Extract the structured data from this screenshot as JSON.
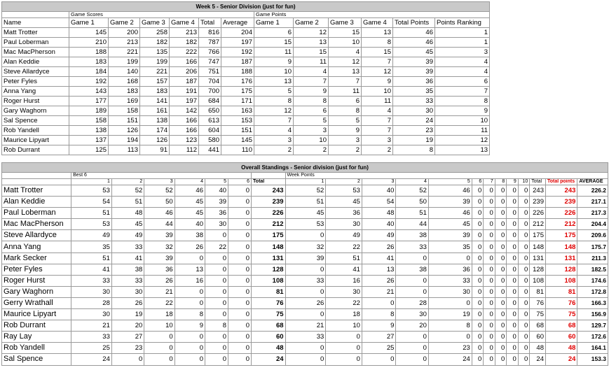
{
  "week": {
    "title": "Week 5 - Senior Division (just for fun)",
    "group_scores": "Game Scores",
    "group_points": "Game Points",
    "headers": [
      "Name",
      "Game 1",
      "Game 2",
      "Game 3",
      "Game 4",
      "Total",
      "Average",
      "Game 1",
      "Game 2",
      "Game 3",
      "Game 4",
      "Total Points",
      "Points Ranking"
    ],
    "rows": [
      [
        "Matt Trotter",
        "145",
        "200",
        "258",
        "213",
        "816",
        "204",
        "6",
        "12",
        "15",
        "13",
        "46",
        "1"
      ],
      [
        "Paul Loberman",
        "210",
        "213",
        "182",
        "182",
        "787",
        "197",
        "15",
        "13",
        "10",
        "8",
        "46",
        "1"
      ],
      [
        "Mac MacPherson",
        "188",
        "221",
        "135",
        "222",
        "766",
        "192",
        "11",
        "15",
        "4",
        "15",
        "45",
        "3"
      ],
      [
        "Alan Keddie",
        "183",
        "199",
        "199",
        "166",
        "747",
        "187",
        "9",
        "11",
        "12",
        "7",
        "39",
        "4"
      ],
      [
        "Steve Allardyce",
        "184",
        "140",
        "221",
        "206",
        "751",
        "188",
        "10",
        "4",
        "13",
        "12",
        "39",
        "4"
      ],
      [
        "Peter Fyles",
        "192",
        "168",
        "157",
        "187",
        "704",
        "176",
        "13",
        "7",
        "7",
        "9",
        "36",
        "6"
      ],
      [
        "Anna Yang",
        "143",
        "183",
        "183",
        "191",
        "700",
        "175",
        "5",
        "9",
        "11",
        "10",
        "35",
        "7"
      ],
      [
        "Roger Hurst",
        "177",
        "169",
        "141",
        "197",
        "684",
        "171",
        "8",
        "8",
        "6",
        "11",
        "33",
        "8"
      ],
      [
        "Gary Waghorn",
        "189",
        "158",
        "161",
        "142",
        "650",
        "163",
        "12",
        "6",
        "8",
        "4",
        "30",
        "9"
      ],
      [
        "Sal Spence",
        "158",
        "151",
        "138",
        "166",
        "613",
        "153",
        "7",
        "5",
        "5",
        "7",
        "24",
        "10"
      ],
      [
        "Rob Yandell",
        "138",
        "126",
        "174",
        "166",
        "604",
        "151",
        "4",
        "3",
        "9",
        "7",
        "23",
        "11"
      ],
      [
        "Maurice Lipyart",
        "137",
        "194",
        "126",
        "123",
        "580",
        "145",
        "3",
        "10",
        "3",
        "3",
        "19",
        "12"
      ],
      [
        "Rob Durrant",
        "125",
        "113",
        "91",
        "112",
        "441",
        "110",
        "2",
        "2",
        "2",
        "2",
        "8",
        "13"
      ]
    ]
  },
  "overall": {
    "title": "Overall Standings  - Senior division (just for fun)",
    "best6": "Best 6",
    "week_points": "Week Points",
    "col_nums_a": [
      "1",
      "2",
      "3",
      "4",
      "5",
      "6"
    ],
    "total_label": "Total",
    "col_nums_b": [
      "1",
      "2",
      "3",
      "4",
      "5",
      "6",
      "7",
      "8",
      "9",
      "10"
    ],
    "total_label_2": "Total",
    "total_points_label": "Total points",
    "average_label": "AVERAGE",
    "rows": [
      {
        "name": "Matt Trotter",
        "best": [
          "53",
          "52",
          "52",
          "46",
          "40",
          "0"
        ],
        "total": "243",
        "wk": [
          "52",
          "53",
          "40",
          "52",
          "46",
          "0",
          "0",
          "0",
          "0",
          "0"
        ],
        "wtotal": "243",
        "tp": "243",
        "avg": "226.2"
      },
      {
        "name": "Alan Keddie",
        "best": [
          "54",
          "51",
          "50",
          "45",
          "39",
          "0"
        ],
        "total": "239",
        "wk": [
          "51",
          "45",
          "54",
          "50",
          "39",
          "0",
          "0",
          "0",
          "0",
          "0"
        ],
        "wtotal": "239",
        "tp": "239",
        "avg": "217.1"
      },
      {
        "name": "Paul Loberman",
        "best": [
          "51",
          "48",
          "46",
          "45",
          "36",
          "0"
        ],
        "total": "226",
        "wk": [
          "45",
          "36",
          "48",
          "51",
          "46",
          "0",
          "0",
          "0",
          "0",
          "0"
        ],
        "wtotal": "226",
        "tp": "226",
        "avg": "217.3"
      },
      {
        "name": "Mac MacPherson",
        "best": [
          "53",
          "45",
          "44",
          "40",
          "30",
          "0"
        ],
        "total": "212",
        "wk": [
          "53",
          "30",
          "40",
          "44",
          "45",
          "0",
          "0",
          "0",
          "0",
          "0"
        ],
        "wtotal": "212",
        "tp": "212",
        "avg": "204.4"
      },
      {
        "name": "Steve Allardyce",
        "best": [
          "49",
          "49",
          "39",
          "38",
          "0",
          "0"
        ],
        "total": "175",
        "wk": [
          "0",
          "49",
          "49",
          "38",
          "39",
          "0",
          "0",
          "0",
          "0",
          "0"
        ],
        "wtotal": "175",
        "tp": "175",
        "avg": "209.6"
      },
      {
        "name": "Anna Yang",
        "best": [
          "35",
          "33",
          "32",
          "26",
          "22",
          "0"
        ],
        "total": "148",
        "wk": [
          "32",
          "22",
          "26",
          "33",
          "35",
          "0",
          "0",
          "0",
          "0",
          "0"
        ],
        "wtotal": "148",
        "tp": "148",
        "avg": "175.7"
      },
      {
        "name": "Mark Secker",
        "best": [
          "51",
          "41",
          "39",
          "0",
          "0",
          "0"
        ],
        "total": "131",
        "wk": [
          "39",
          "51",
          "41",
          "0",
          "0",
          "0",
          "0",
          "0",
          "0",
          "0"
        ],
        "wtotal": "131",
        "tp": "131",
        "avg": "211.3"
      },
      {
        "name": "Peter Fyles",
        "best": [
          "41",
          "38",
          "36",
          "13",
          "0",
          "0"
        ],
        "total": "128",
        "wk": [
          "0",
          "41",
          "13",
          "38",
          "36",
          "0",
          "0",
          "0",
          "0",
          "0"
        ],
        "wtotal": "128",
        "tp": "128",
        "avg": "182.5"
      },
      {
        "name": "Roger Hurst",
        "best": [
          "33",
          "33",
          "26",
          "16",
          "0",
          "0"
        ],
        "total": "108",
        "wk": [
          "33",
          "16",
          "26",
          "0",
          "33",
          "0",
          "0",
          "0",
          "0",
          "0"
        ],
        "wtotal": "108",
        "tp": "108",
        "avg": "174.6"
      },
      {
        "name": "Gary Waghorn",
        "best": [
          "30",
          "30",
          "21",
          "0",
          "0",
          "0"
        ],
        "total": "81",
        "wk": [
          "0",
          "30",
          "21",
          "0",
          "30",
          "0",
          "0",
          "0",
          "0",
          "0"
        ],
        "wtotal": "81",
        "tp": "81",
        "avg": "172.8"
      },
      {
        "name": "Gerry Wrathall",
        "best": [
          "28",
          "26",
          "22",
          "0",
          "0",
          "0"
        ],
        "total": "76",
        "wk": [
          "26",
          "22",
          "0",
          "28",
          "0",
          "0",
          "0",
          "0",
          "0",
          "0"
        ],
        "wtotal": "76",
        "tp": "76",
        "avg": "166.3"
      },
      {
        "name": "Maurice Lipyart",
        "best": [
          "30",
          "19",
          "18",
          "8",
          "0",
          "0"
        ],
        "total": "75",
        "wk": [
          "0",
          "18",
          "8",
          "30",
          "19",
          "0",
          "0",
          "0",
          "0",
          "0"
        ],
        "wtotal": "75",
        "tp": "75",
        "avg": "156.9"
      },
      {
        "name": "Rob Durrant",
        "best": [
          "21",
          "20",
          "10",
          "9",
          "8",
          "0"
        ],
        "total": "68",
        "wk": [
          "21",
          "10",
          "9",
          "20",
          "8",
          "0",
          "0",
          "0",
          "0",
          "0"
        ],
        "wtotal": "68",
        "tp": "68",
        "avg": "129.7"
      },
      {
        "name": "Ray Lay",
        "best": [
          "33",
          "27",
          "0",
          "0",
          "0",
          "0"
        ],
        "total": "60",
        "wk": [
          "33",
          "0",
          "27",
          "0",
          "0",
          "0",
          "0",
          "0",
          "0",
          "0"
        ],
        "wtotal": "60",
        "tp": "60",
        "avg": "172.6"
      },
      {
        "name": "Rob Yandell",
        "best": [
          "25",
          "23",
          "0",
          "0",
          "0",
          "0"
        ],
        "total": "48",
        "wk": [
          "0",
          "0",
          "25",
          "0",
          "23",
          "0",
          "0",
          "0",
          "0",
          "0"
        ],
        "wtotal": "48",
        "tp": "48",
        "avg": "164.1"
      },
      {
        "name": "Sal Spence",
        "best": [
          "24",
          "0",
          "0",
          "0",
          "0",
          "0"
        ],
        "total": "24",
        "wk": [
          "0",
          "0",
          "0",
          "0",
          "24",
          "0",
          "0",
          "0",
          "0",
          "0"
        ],
        "wtotal": "24",
        "tp": "24",
        "avg": "153.3"
      }
    ]
  }
}
